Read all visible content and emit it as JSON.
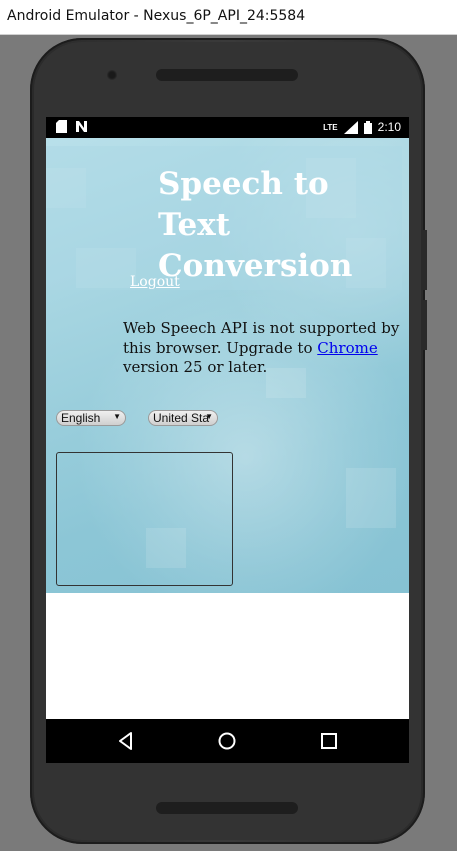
{
  "window": {
    "title": "Android Emulator - Nexus_6P_API_24:5584"
  },
  "statusbar": {
    "time": "2:10",
    "network": "LTE"
  },
  "page": {
    "title": "Speech to Text Conversion",
    "logout_label": "Logout",
    "message_pre": "Web Speech API is not supported by this browser. Upgrade to ",
    "message_link": "Chrome",
    "message_post": " version 25 or later.",
    "language_select": {
      "selected": "English"
    },
    "dialect_select": {
      "selected": "United Sta"
    },
    "transcript_text": ""
  },
  "nav": {
    "back": "back-icon",
    "home": "home-icon",
    "recents": "recents-icon"
  }
}
